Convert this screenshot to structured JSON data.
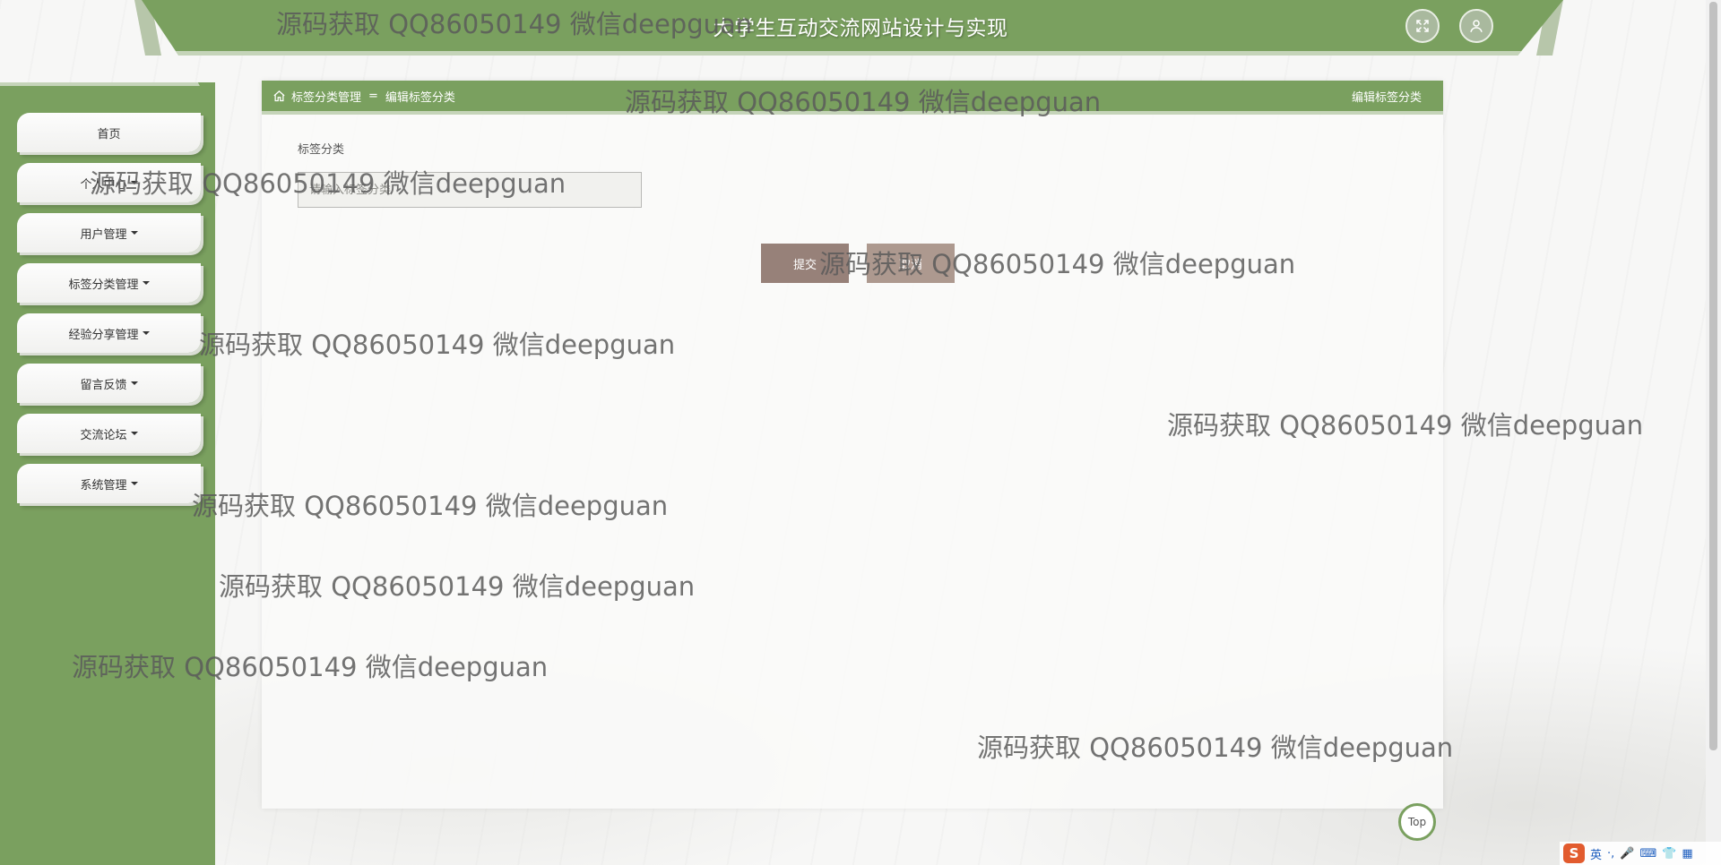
{
  "app": {
    "title": "大学生互动交流网站设计与实现"
  },
  "header": {
    "fullscreen_icon": "expand-icon",
    "user_icon": "user-icon"
  },
  "sidebar": {
    "items": [
      {
        "label": "首页",
        "has_dropdown": false
      },
      {
        "label": "个人中心",
        "has_dropdown": true
      },
      {
        "label": "用户管理",
        "has_dropdown": true
      },
      {
        "label": "标签分类管理",
        "has_dropdown": true
      },
      {
        "label": "经验分享管理",
        "has_dropdown": true
      },
      {
        "label": "留言反馈",
        "has_dropdown": true
      },
      {
        "label": "交流论坛",
        "has_dropdown": true
      },
      {
        "label": "系统管理",
        "has_dropdown": true
      }
    ]
  },
  "breadcrumb": {
    "home_icon": "home-icon",
    "items": [
      "标签分类管理",
      "编辑标签分类"
    ],
    "separator": "=",
    "page_label": "编辑标签分类"
  },
  "form": {
    "field_label": "标签分类",
    "field_value": "",
    "field_placeholder": "请输入标签分类",
    "submit_label": "提交",
    "cancel_label": "取消"
  },
  "back_to_top_label": "Top",
  "ime": {
    "logo": "S",
    "lang": "英"
  },
  "watermark_text": "源码获取 QQ86050149 微信deepguan",
  "colors": {
    "primary": "#7aa05f",
    "primary_light": "#c5d4b9",
    "submit_bg": "#978179",
    "cancel_bg": "#ad998f"
  }
}
